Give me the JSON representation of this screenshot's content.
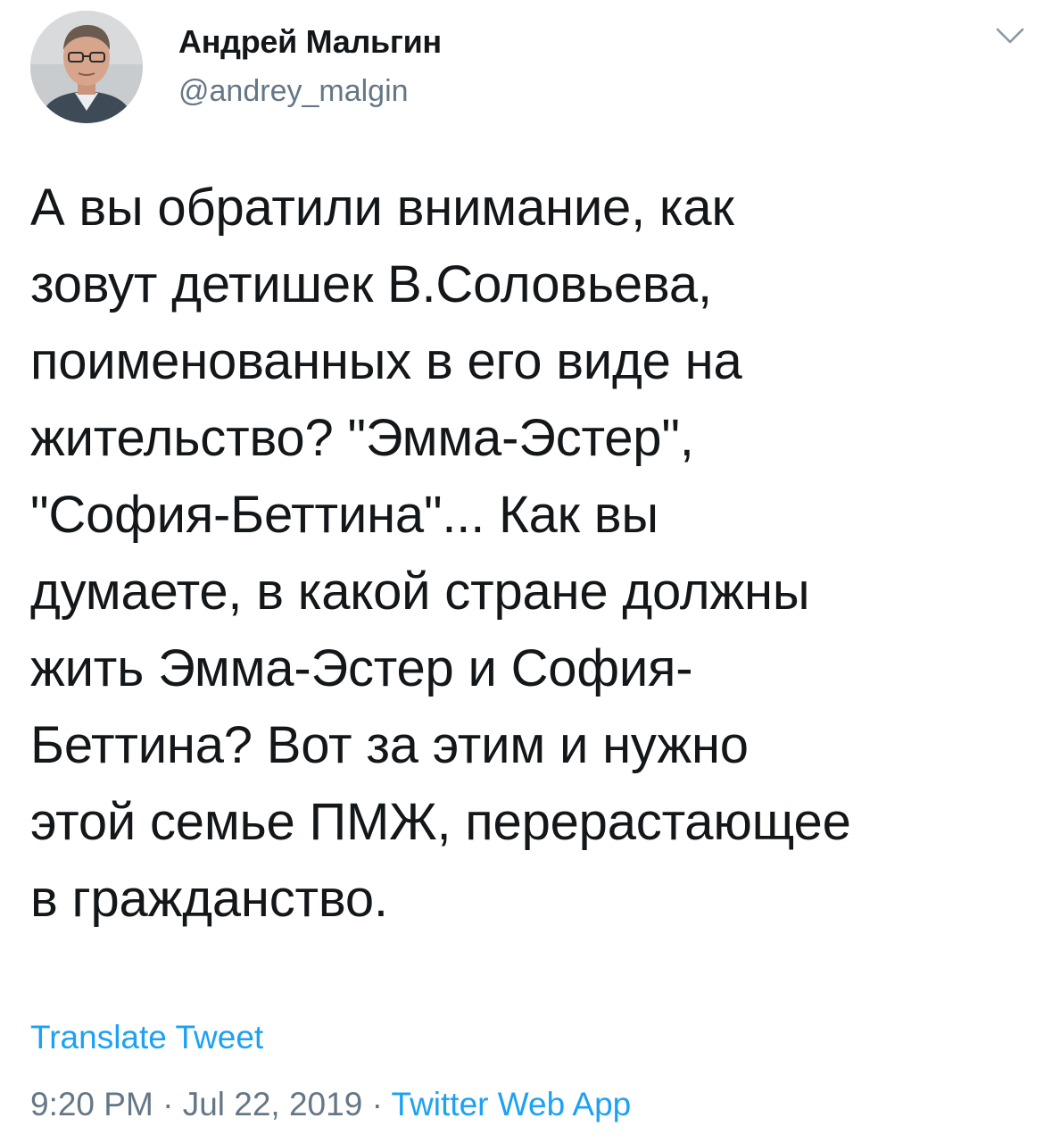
{
  "author": {
    "display_name": "Андрей Мальгин",
    "handle": "@andrey_malgin",
    "avatar_icon": "user-avatar-photo"
  },
  "menu": {
    "icon": "chevron-down-icon"
  },
  "tweet": {
    "lines": [
      "А вы обратили внимание, как",
      "зовут детишек В.Соловьева,",
      "поименованных в его виде на",
      "жительство? \"Эмма-Эстер\",",
      "\"София-Беттина\"... Как вы",
      "думаете, в какой стране должны",
      "жить Эмма-Эстер и София-",
      "Беттина? Вот за этим и нужно",
      "этой семье ПМЖ, перерастающее",
      "в гражданство."
    ]
  },
  "actions": {
    "translate_label": "Translate Tweet"
  },
  "meta": {
    "time": "9:20 PM",
    "separator": "·",
    "date": "Jul 22, 2019",
    "source": "Twitter Web App"
  },
  "colors": {
    "text": "#14171a",
    "secondary": "#657786",
    "link": "#1da1f2"
  }
}
